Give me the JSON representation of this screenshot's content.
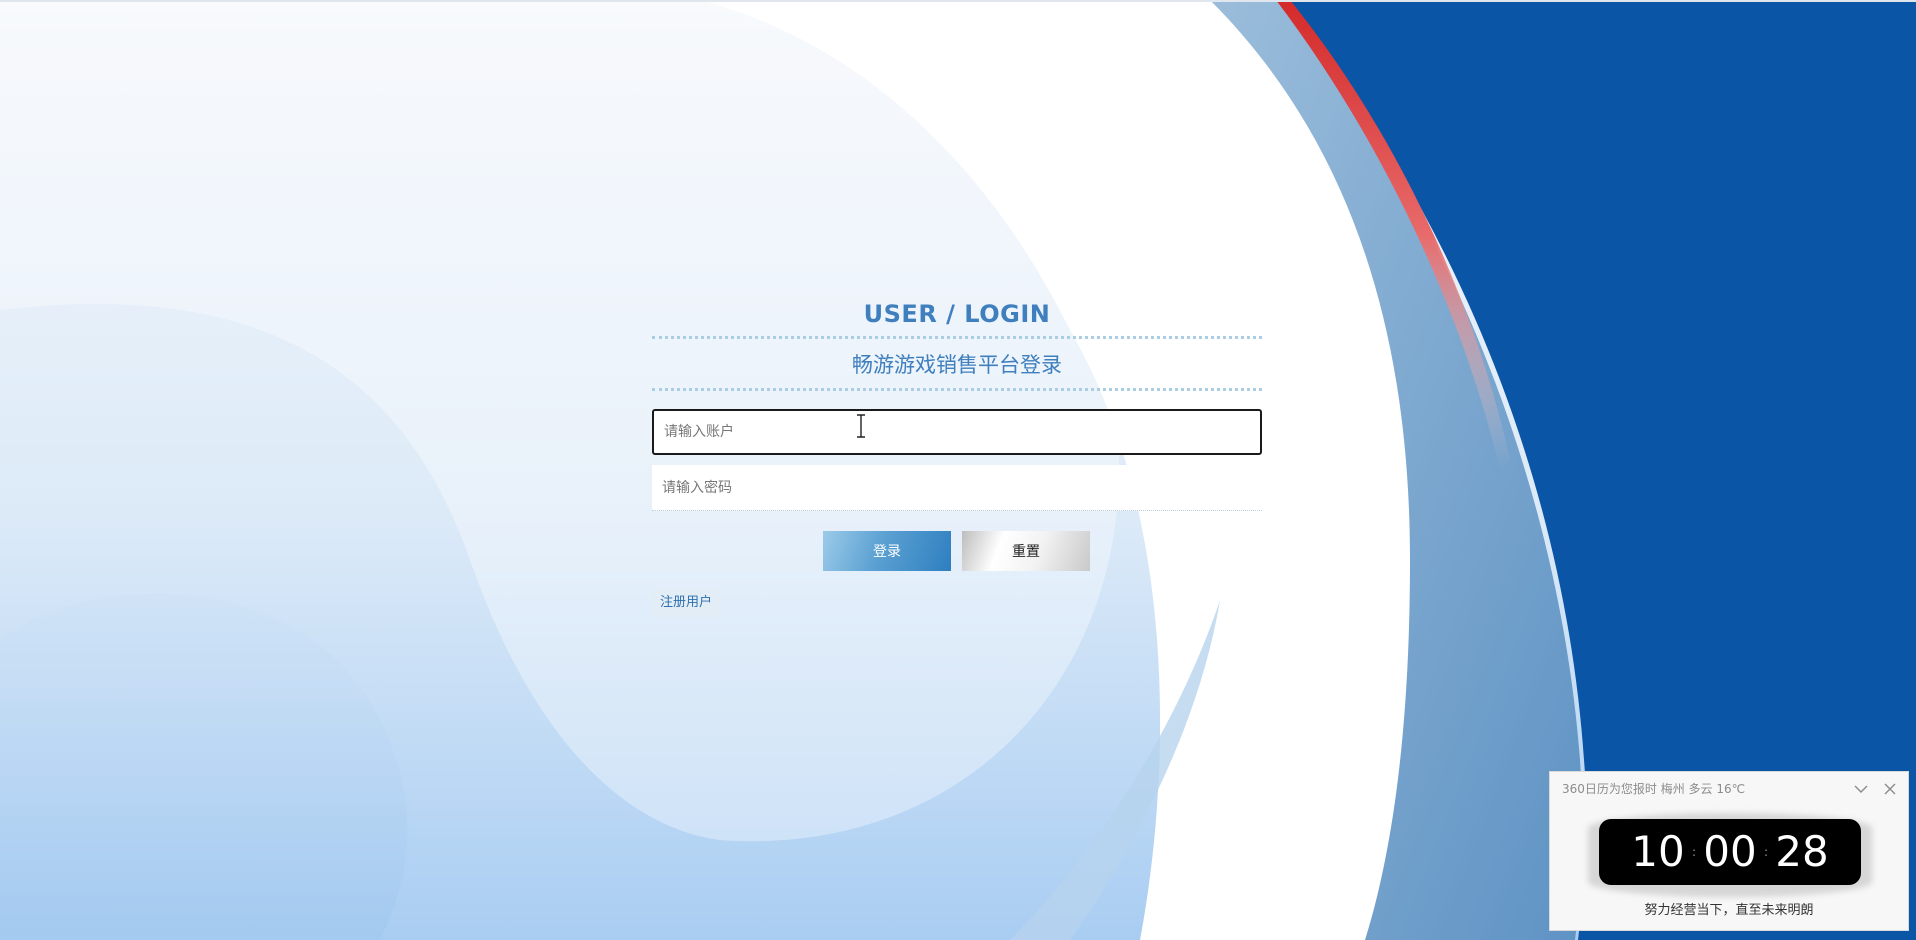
{
  "login": {
    "title": "USER / LOGIN",
    "subtitle": "畅游游戏销售平台登录",
    "account_placeholder": "请输入账户",
    "password_placeholder": "请输入密码",
    "login_label": "登录",
    "reset_label": "重置",
    "register_label": "注册用户"
  },
  "clock_widget": {
    "header": "360日历为您报时 梅州 多云 16℃",
    "hours": "10",
    "minutes": "00",
    "seconds": "28",
    "motto": "努力经营当下，直至未来明朗"
  },
  "colors": {
    "accent_blue": "#3f7fbe",
    "deep_blue": "#0a55a5",
    "red_stripe": "#e23b3b"
  }
}
